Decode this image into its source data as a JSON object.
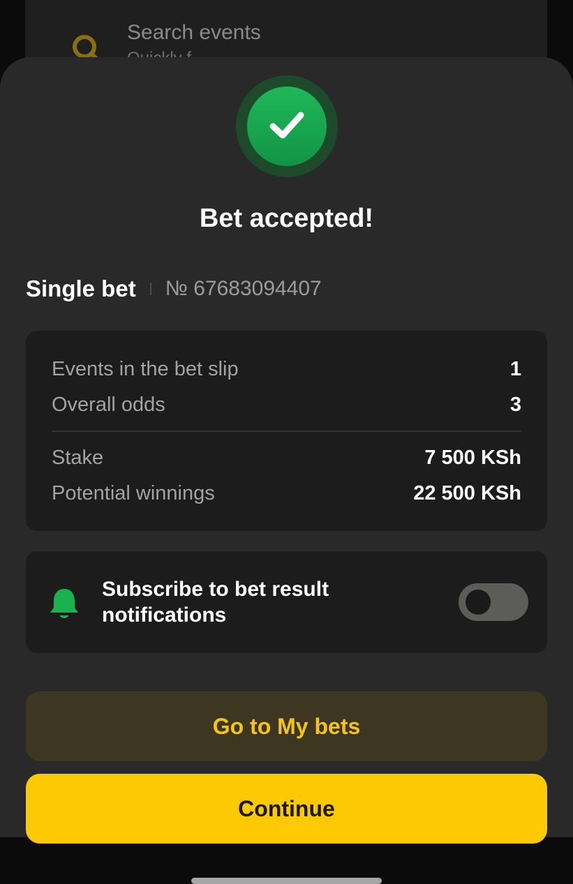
{
  "background": {
    "search_title": "Search events",
    "search_subtitle": "Quickly f"
  },
  "dialog": {
    "title": "Bet accepted!",
    "bet_type": "Single bet",
    "bet_number": "№ 67683094407"
  },
  "summary": {
    "rows": [
      {
        "label": "Events in the bet slip",
        "value": "1"
      },
      {
        "label": "Overall odds",
        "value": "3"
      },
      {
        "label": "Stake",
        "value": "7 500 KSh"
      },
      {
        "label": "Potential winnings",
        "value": "22 500 KSh"
      }
    ]
  },
  "notifications": {
    "label": "Subscribe to bet result notifications",
    "toggle_on": false
  },
  "buttons": {
    "my_bets": "Go to My bets",
    "continue": "Continue"
  },
  "colors": {
    "accent": "#fdc903",
    "success": "#18a54f",
    "sheet": "#292929",
    "card": "#1c1c1c"
  },
  "icons": {
    "success": "check-icon",
    "notification": "bell-icon",
    "search": "search-icon"
  }
}
